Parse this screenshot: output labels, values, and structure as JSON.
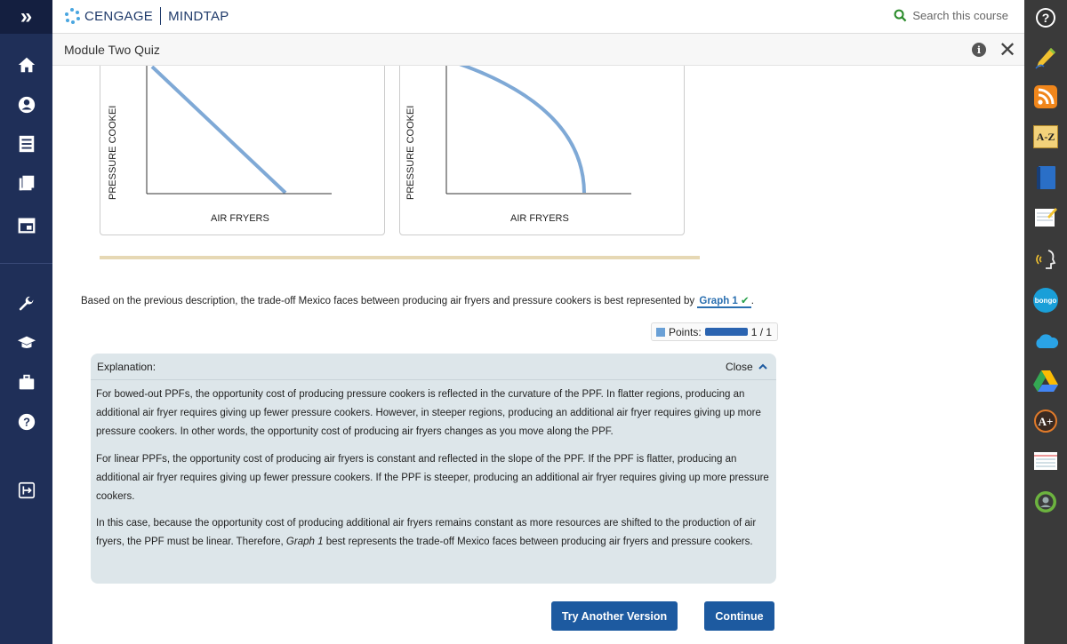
{
  "nav": {
    "expand_glyph": "»"
  },
  "brand": {
    "name": "CENGAGE",
    "product": "MINDTAP"
  },
  "search": {
    "placeholder": "Search this course"
  },
  "header": {
    "title": "Module Two Quiz"
  },
  "graphs": [
    {
      "ylabel": "PRESSURE COOKEI",
      "xlabel": "AIR FRYERS",
      "curve": "linear"
    },
    {
      "ylabel": "PRESSURE COOKEI",
      "xlabel": "AIR FRYERS",
      "curve": "bowed-out"
    }
  ],
  "question": {
    "text": "Based on the previous description, the trade-off Mexico faces between producing air fryers and pressure cookers is best represented by",
    "answer": "Graph 1",
    "check": "✔",
    "period": "."
  },
  "points": {
    "label": "Points:",
    "value": "1 / 1",
    "fraction": 1.0
  },
  "explanation": {
    "label": "Explanation:",
    "close_label": "Close",
    "paragraphs": [
      "For bowed-out PPFs, the opportunity cost of producing pressure cookers is reflected in the curvature of the PPF. In flatter regions, producing an additional air fryer requires giving up fewer pressure cookers. However, in steeper regions, producing an additional air fryer requires giving up more pressure cookers. In other words, the opportunity cost of producing air fryers changes as you move along the PPF.",
      "For linear PPFs, the opportunity cost of producing air fryers is constant and reflected in the slope of the PPF. If the PPF is flatter, producing an additional air fryer requires giving up fewer pressure cookers. If the PPF is steeper, producing an additional air fryer requires giving up more pressure cookers.",
      "In this case, because the opportunity cost of producing additional air fryers remains constant as more resources are shifted to the production of air fryers, the PPF must be linear. Therefore,",
      "Graph 1",
      "best represents the trade-off Mexico faces between producing air fryers and pressure cookers."
    ]
  },
  "buttons": {
    "try_another": "Try Another Version",
    "continue": "Continue"
  },
  "right_rail": {
    "az_label": "A-Z",
    "bongo_label": "bongo"
  },
  "colors": {
    "rail": "#1f2f58",
    "accent": "#1d5aa0",
    "curve": "#7fa9d6",
    "check": "#27a04a"
  }
}
